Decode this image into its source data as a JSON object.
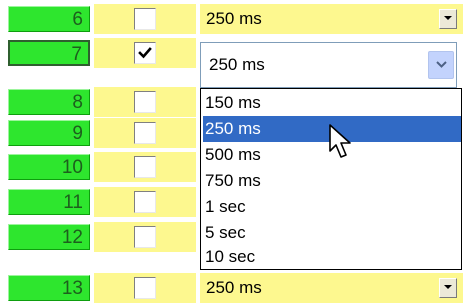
{
  "rows": [
    {
      "number": "6",
      "checked": false,
      "value": "250 ms"
    },
    {
      "number": "7",
      "checked": true,
      "value": "250 ms"
    },
    {
      "number": "8",
      "checked": false
    },
    {
      "number": "9",
      "checked": false
    },
    {
      "number": "10",
      "checked": false
    },
    {
      "number": "11",
      "checked": false
    },
    {
      "number": "12",
      "checked": false
    },
    {
      "number": "13",
      "checked": false,
      "value": "250 ms"
    }
  ],
  "dropdown": {
    "options": [
      "150 ms",
      "250 ms",
      "500 ms",
      "750 ms",
      "1 sec",
      "5 sec",
      "10 sec"
    ],
    "selected_index": 1
  },
  "icons": {
    "check": "check-mark-icon",
    "dropdown": "chevron-down-icon",
    "cursor": "mouse-pointer-icon"
  },
  "colors": {
    "number_cell": "#2ee62e",
    "cell_background": "#fdf88f",
    "selection": "#316ac5"
  }
}
